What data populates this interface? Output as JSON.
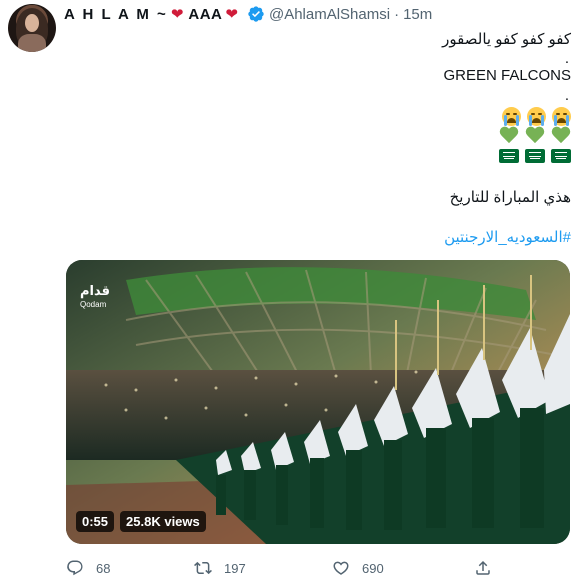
{
  "tweet": {
    "author": {
      "display_name": "A H L A M ~",
      "display_name_suffix": "AAA",
      "heart_emoji": "❤",
      "handle": "@AhlamAlShamsi",
      "verified_icon": "verified-badge-icon",
      "separator": "·",
      "time": "15m"
    },
    "text": {
      "line1": "كفو كفو كفو يالصقور",
      "dot1": ".",
      "line2": "GREEN FALCONS",
      "dot2": ".",
      "emoji_rows": [
        "crying-face",
        "green-heart",
        "saudi-flag"
      ],
      "line3": "هذي المباراة للتاريخ",
      "hashtag": "#السعوديه_الارجنتين"
    },
    "media": {
      "watermark_ar": "قدام",
      "watermark_en": "Qodam",
      "duration": "0:55",
      "views": "25.8K views"
    },
    "actions": {
      "reply_count": "68",
      "retweet_count": "197",
      "like_count": "690"
    },
    "colors": {
      "link": "#1d9bf0",
      "secondary_text": "#536471",
      "verified": "#1d9bf0",
      "heart": "#d01c3a",
      "green_heart": "#77b255",
      "saudi_green": "#006c35"
    }
  }
}
